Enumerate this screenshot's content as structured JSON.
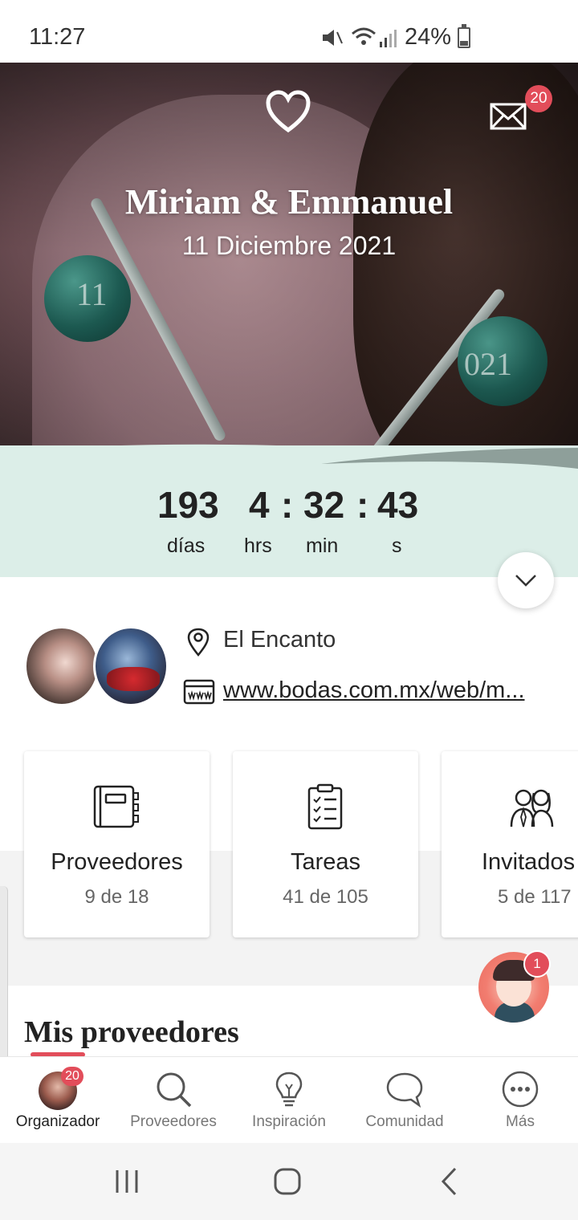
{
  "status_bar": {
    "time": "11:27",
    "battery": "24%",
    "icons": [
      "mute-icon",
      "wifi-icon",
      "signal-icon",
      "battery-icon"
    ]
  },
  "header": {
    "couple_names": "Miriam & Emmanuel",
    "wedding_date": "11 Diciembre 2021",
    "messages_badge": "20",
    "logo_icon": "heart-logo-icon",
    "mail_icon": "mail-icon"
  },
  "photo": {
    "ornament_left_text": "11",
    "ornament_right_text": "021"
  },
  "countdown": {
    "days": "193",
    "hours": "4",
    "minutes": "32",
    "seconds": "43",
    "separator": ":",
    "days_label": "días",
    "hours_label": "hrs",
    "minutes_label": "min",
    "seconds_label": "s"
  },
  "info": {
    "venue": "El Encanto",
    "website": "www.bodas.com.mx/web/m..."
  },
  "cards": [
    {
      "title": "Proveedores",
      "subtitle": "9 de 18",
      "icon": "notebook-icon"
    },
    {
      "title": "Tareas",
      "subtitle": "41 de 105",
      "icon": "clipboard-icon"
    },
    {
      "title": "Invitados",
      "subtitle": "5 de 117",
      "icon": "guests-icon"
    }
  ],
  "section": {
    "title": "Mis proveedores"
  },
  "assistant": {
    "badge": "1"
  },
  "bottom_nav": {
    "items": [
      {
        "label": "Organizador",
        "badge": "20",
        "active": true
      },
      {
        "label": "Proveedores"
      },
      {
        "label": "Inspiración"
      },
      {
        "label": "Comunidad"
      },
      {
        "label": "Más"
      }
    ]
  },
  "colors": {
    "accent": "#e24d5a",
    "countdown_bg": "#dceee8"
  }
}
